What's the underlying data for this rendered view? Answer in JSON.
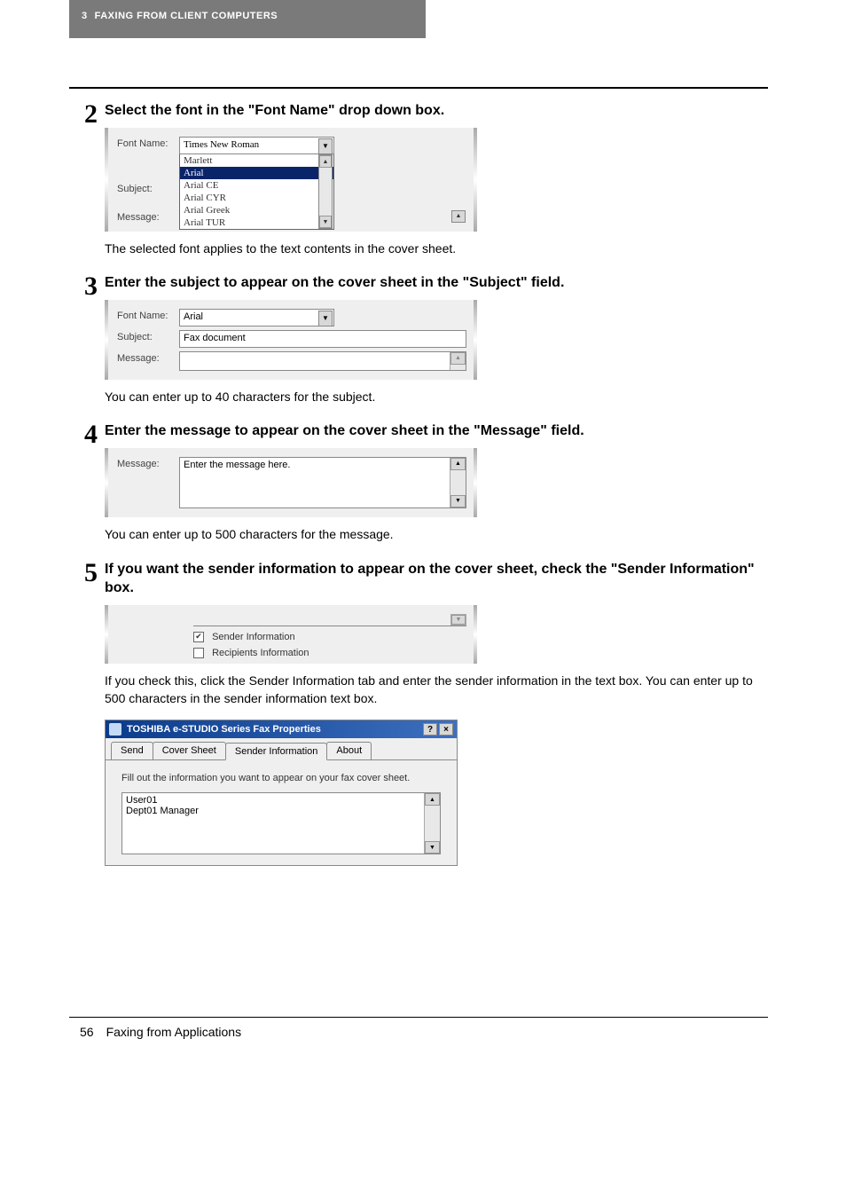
{
  "header": {
    "section_num": "3",
    "section_title": "FAXING FROM CLIENT COMPUTERS"
  },
  "step2": {
    "num": "2",
    "title": "Select the font in the \"Font Name\" drop down box.",
    "labels": {
      "font_name": "Font Name:",
      "subject": "Subject:",
      "message": "Message:"
    },
    "selected_font": "Times New Roman",
    "options": [
      "Marlett",
      "Arial",
      "Arial CE",
      "Arial CYR",
      "Arial Greek",
      "Arial TUR"
    ],
    "options_selected_index": 1,
    "desc": "The selected font applies to the text contents in the cover sheet."
  },
  "step3": {
    "num": "3",
    "title": "Enter the subject to appear on the cover sheet in the \"Subject\" field.",
    "labels": {
      "font_name": "Font Name:",
      "subject": "Subject:",
      "message": "Message:"
    },
    "font_value": "Arial",
    "subject_value": "Fax document",
    "desc": "You can enter up to 40 characters for the subject."
  },
  "step4": {
    "num": "4",
    "title": "Enter the message to appear on the cover sheet in the \"Message\" field.",
    "labels": {
      "message": "Message:"
    },
    "message_value": "Enter the message here.",
    "desc": "You can enter up to 500 characters for the message."
  },
  "step5": {
    "num": "5",
    "title": "If you want the sender information to appear on the cover sheet, check the \"Sender Information\" box.",
    "sender_check_label": "Sender Information",
    "recipients_check_label": "Recipients Information",
    "sender_checked": true,
    "recipients_checked": false,
    "desc": "If you check this, click the Sender Information tab and enter the sender information in the text box. You can enter up to 500 characters in the sender information text box.",
    "dialog": {
      "title": "TOSHIBA e-STUDIO Series Fax Properties",
      "help_btn": "?",
      "close_btn": "×",
      "tabs": [
        "Send",
        "Cover Sheet",
        "Sender Information",
        "About"
      ],
      "active_tab_index": 2,
      "hint": "Fill out the information you want to appear on your fax cover sheet.",
      "info_text": "User01\nDept01 Manager"
    }
  },
  "footer": {
    "page_num": "56",
    "page_title": "Faxing from Applications"
  }
}
